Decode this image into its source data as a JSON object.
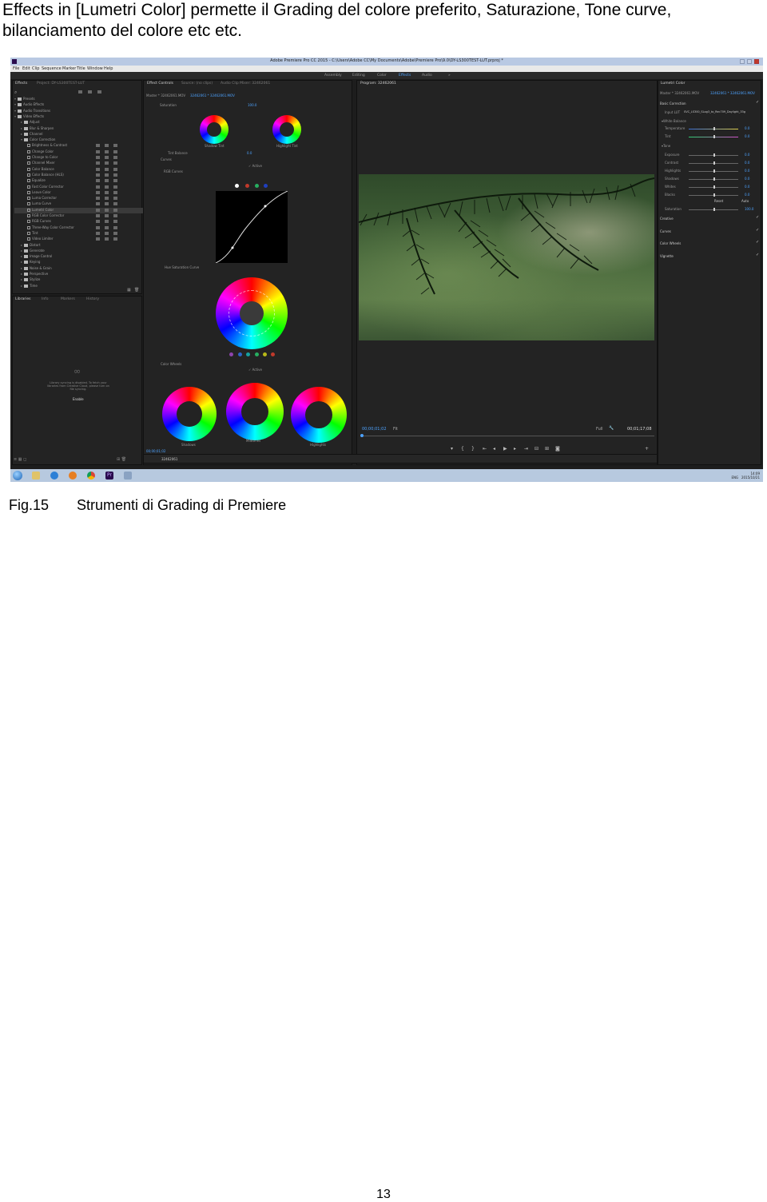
{
  "intro_text": "Effects in [Lumetri Color] permette il Grading del colore preferito, Saturazione, Tone curve, bilanciamento del colore etc etc.",
  "screenshot": {
    "window_title": "Adobe Premiere Pro CC 2015 - C:\\Users\\Adobe CC\\My Documents\\Adobe\\Premiere Pro\\9.0\\DY-LS300TEST-LUT.prproj *",
    "menu": [
      "File",
      "Edit",
      "Clip",
      "Sequence",
      "Marker",
      "Title",
      "Window",
      "Help"
    ],
    "workspaces": [
      "Assembly",
      "Editing",
      "Color",
      "Effects",
      "Audio"
    ],
    "active_workspace": "Effects",
    "effects_panel": {
      "tab": "Effects",
      "project_tab": "Project: DY-LS300TEST-LUT",
      "items": [
        {
          "label": "Presets",
          "type": "folder",
          "level": 0
        },
        {
          "label": "Audio Effects",
          "type": "folder",
          "level": 0
        },
        {
          "label": "Audio Transitions",
          "type": "folder",
          "level": 0
        },
        {
          "label": "Video Effects",
          "type": "folder",
          "level": 0
        },
        {
          "label": "Adjust",
          "type": "folder",
          "level": 1
        },
        {
          "label": "Blur & Sharpen",
          "type": "folder",
          "level": 1
        },
        {
          "label": "Channel",
          "type": "folder",
          "level": 1
        },
        {
          "label": "Color Correction",
          "type": "folder",
          "level": 1
        },
        {
          "label": "Brightness & Contrast",
          "type": "fx",
          "level": 2
        },
        {
          "label": "Change Color",
          "type": "fx",
          "level": 2
        },
        {
          "label": "Change to Color",
          "type": "fx",
          "level": 2
        },
        {
          "label": "Channel Mixer",
          "type": "fx",
          "level": 2
        },
        {
          "label": "Color Balance",
          "type": "fx",
          "level": 2
        },
        {
          "label": "Color Balance (HLS)",
          "type": "fx",
          "level": 2
        },
        {
          "label": "Equalize",
          "type": "fx",
          "level": 2
        },
        {
          "label": "Fast Color Corrector",
          "type": "fx",
          "level": 2
        },
        {
          "label": "Leave Color",
          "type": "fx",
          "level": 2
        },
        {
          "label": "Luma Corrector",
          "type": "fx",
          "level": 2
        },
        {
          "label": "Luma Curve",
          "type": "fx",
          "level": 2
        },
        {
          "label": "Lumetri Color",
          "type": "fx",
          "level": 2,
          "selected": true
        },
        {
          "label": "RGB Color Corrector",
          "type": "fx",
          "level": 2
        },
        {
          "label": "RGB Curves",
          "type": "fx",
          "level": 2
        },
        {
          "label": "Three-Way Color Corrector",
          "type": "fx",
          "level": 2
        },
        {
          "label": "Tint",
          "type": "fx",
          "level": 2
        },
        {
          "label": "Video Limiter",
          "type": "fx",
          "level": 2
        },
        {
          "label": "Distort",
          "type": "folder",
          "level": 1
        },
        {
          "label": "Generate",
          "type": "folder",
          "level": 1
        },
        {
          "label": "Image Control",
          "type": "folder",
          "level": 1
        },
        {
          "label": "Keying",
          "type": "folder",
          "level": 1
        },
        {
          "label": "Noise & Grain",
          "type": "folder",
          "level": 1
        },
        {
          "label": "Perspective",
          "type": "folder",
          "level": 1
        },
        {
          "label": "Stylize",
          "type": "folder",
          "level": 1
        },
        {
          "label": "Time",
          "type": "folder",
          "level": 1
        }
      ]
    },
    "libraries_panel": {
      "tabs": [
        "Libraries",
        "Info",
        "Markers",
        "History"
      ],
      "message": "Library syncing is disabled. To fetch your libraries from Creative Cloud, please turn on file syncing.",
      "enable_label": "Enable"
    },
    "effect_controls": {
      "tabs": [
        "Effect Controls",
        "Source: (no clips)",
        "Audio Clip Mixer: 32462061"
      ],
      "master": "Master * 32462061.MOV",
      "clip": "32462061 * 32462061.MOV",
      "saturation_label": "Saturation",
      "saturation_value": "100.0",
      "shadow_tint_label": "Shadow Tint",
      "highlight_tint_label": "Highlight Tint",
      "tint_balance_label": "Tint Balance",
      "tint_balance_value": "0.0",
      "curves_label": "Curves",
      "active_label": "Active",
      "rgb_curves_label": "RGB Curves",
      "hue_saturation_label": "Hue Saturation Curve",
      "color_wheels_label": "Color Wheels",
      "shadows_label": "Shadows",
      "midtones_label": "Midtones",
      "highlights_label": "Highlights",
      "timecode": "00;00;01;02"
    },
    "program_monitor": {
      "tab": "Program: 32462061",
      "timecode": "00;00;01;02",
      "fit": "Fit",
      "quality": "Full",
      "duration": "00;01;17;08"
    },
    "lumetri_panel": {
      "tab": "Lumetri Color",
      "clip": "Master * 32462061.MOV",
      "clip2": "32462061 * 32462061.MOV",
      "basic_correction": "Basic Correction",
      "input_lut_label": "Input LUT",
      "input_lut_value": "SVC_LS300_SLog3_to_Rec709_Daylight_33g",
      "white_balance": "White Balance",
      "tone": "Tone",
      "sliders": [
        {
          "label": "Temperature",
          "value": "0.0",
          "level": 0.5
        },
        {
          "label": "Tint",
          "value": "0.0",
          "level": 0.5
        },
        {
          "label": "Exposure",
          "value": "0.0",
          "level": 0.5
        },
        {
          "label": "Contrast",
          "value": "0.0",
          "level": 0.5
        },
        {
          "label": "Highlights",
          "value": "0.0",
          "level": 0.5
        },
        {
          "label": "Shadows",
          "value": "0.0",
          "level": 0.5
        },
        {
          "label": "Whites",
          "value": "0.0",
          "level": 0.5
        },
        {
          "label": "Blacks",
          "value": "0.0",
          "level": 0.5
        },
        {
          "label": "Saturation",
          "value": "100.0",
          "level": 0.5
        }
      ],
      "reset_label": "Reset",
      "auto_label": "Auto",
      "sections": [
        "Creative",
        "Curves",
        "Color Wheels",
        "Vignette"
      ]
    },
    "timeline_tab": "32462061",
    "taskbar": {
      "tray_time": "14:09",
      "tray_date": "2015/10/21",
      "tray_lang": "ENG"
    }
  },
  "caption": {
    "figure": "Fig.15",
    "text": "Strumenti di Grading di Premiere"
  },
  "page_number": "13"
}
